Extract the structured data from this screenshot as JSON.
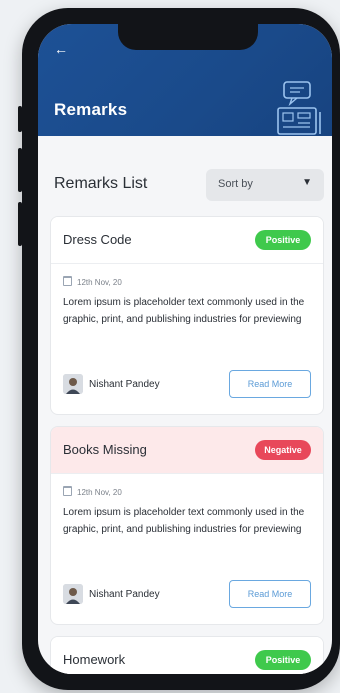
{
  "header": {
    "back_icon": "arrow-left-icon",
    "title": "Remarks",
    "illustration_icon": "notice-board-icon",
    "color": "#1d5196"
  },
  "toolbar": {
    "list_title": "Remarks List",
    "sort_label": "Sort by",
    "sort_icon": "caret-down-icon"
  },
  "cards": [
    {
      "title": "Dress Code",
      "badge": "Positive",
      "badge_color": "#3fc94c",
      "date": "12th Nov, 20",
      "description": "Lorem ipsum is placeholder text commonly used in the graphic, print, and publishing industries for previewing",
      "author": "Nishant Pandey",
      "action": "Read More"
    },
    {
      "title": "Books Missing",
      "badge": "Negative",
      "badge_color": "#e8485a",
      "date": "12th Nov, 20",
      "description": "Lorem ipsum is placeholder text commonly used in the graphic, print, and publishing industries for previewing",
      "author": "Nishant Pandey",
      "action": "Read More"
    },
    {
      "title": "Homework",
      "badge": "Positive",
      "badge_color": "#3fc94c"
    }
  ]
}
